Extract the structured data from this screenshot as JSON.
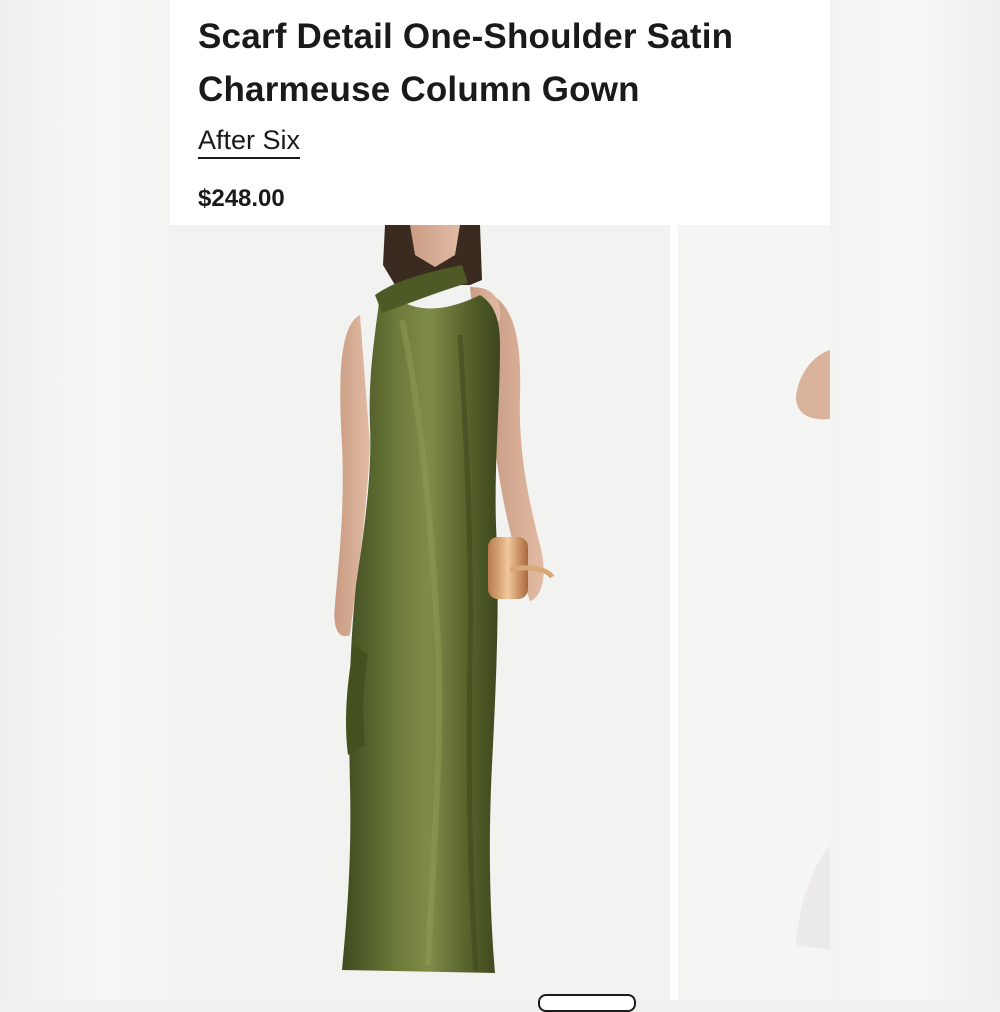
{
  "product": {
    "title": "Scarf Detail One-Shoulder Satin Charmeuse Column Gown",
    "brand": "After Six",
    "price": "$248.00"
  },
  "gallery": {
    "main_image": "olive-green-one-shoulder-satin-gown-photo",
    "next_image": "partial-model-photo"
  },
  "colors": {
    "gown": "#5f6b33",
    "text": "#1a1a1a",
    "background": "#ffffff"
  }
}
